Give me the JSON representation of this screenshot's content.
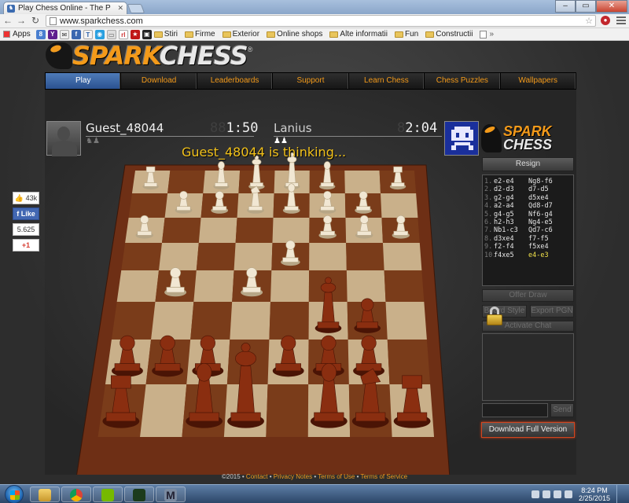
{
  "browser": {
    "tab_title": "Play Chess Online - The P",
    "url": "www.sparkchess.com",
    "bookmarks_apps": "Apps",
    "bookmark_folders": [
      "Stiri",
      "Firme",
      "Exterior",
      "Online shops",
      "Alte informatii",
      "Fun",
      "Constructii"
    ],
    "more": "»"
  },
  "site": {
    "logo_spark": "SPARK",
    "logo_chess": "CHESS",
    "logo_reg": "®",
    "nav": [
      "Play",
      "Download",
      "Leaderboards",
      "Support",
      "Learn Chess",
      "Chess Puzzles",
      "Wallpapers"
    ]
  },
  "game": {
    "player1": {
      "name": "Guest_48044",
      "captured": "♞♟",
      "clock_dim": "88",
      "clock": "1:50"
    },
    "player2": {
      "name": "Lanius",
      "captured": "♟♟",
      "clock_dim": "8",
      "clock": "2:04"
    },
    "status": "Guest_48044 is thinking...",
    "brand_top": "SPARK",
    "brand_bottom": "CHESS"
  },
  "panel": {
    "resign": "Resign",
    "moves": [
      {
        "n": "1.",
        "w": "e2-e4",
        "b": "Ng8-f6"
      },
      {
        "n": "2.",
        "w": "d2-d3",
        "b": "d7-d5"
      },
      {
        "n": "3.",
        "w": "g2-g4",
        "b": "d5xe4"
      },
      {
        "n": "4.",
        "w": "a2-a4",
        "b": "Qd8-d7"
      },
      {
        "n": "5.",
        "w": "g4-g5",
        "b": "Nf6-g4"
      },
      {
        "n": "6.",
        "w": "h2-h3",
        "b": "Ng4-e5"
      },
      {
        "n": "7.",
        "w": "Nb1-c3",
        "b": "Qd7-c6"
      },
      {
        "n": "8.",
        "w": "d3xe4",
        "b": "f7-f5"
      },
      {
        "n": "9.",
        "w": "f2-f4",
        "b": "f5xe4"
      },
      {
        "n": "10.",
        "w": "f4xe5",
        "b": "e4-e3"
      }
    ],
    "offer_draw": "Offer Draw",
    "board_style": "Board Style",
    "export_pgn": "Export PGN",
    "activate_chat": "Activate Chat",
    "send": "Send",
    "download_full": "Download Full Version"
  },
  "social": {
    "likes": "43k",
    "fb_like": "Like",
    "count": "5.625",
    "gplus": "+1"
  },
  "footer": {
    "copyright": "©2015",
    "links": [
      "Contact",
      "Privacy Notes",
      "Terms of Use",
      "Terms of Service"
    ]
  },
  "taskbar": {
    "time": "8:24 PM",
    "date": "2/25/2015"
  }
}
